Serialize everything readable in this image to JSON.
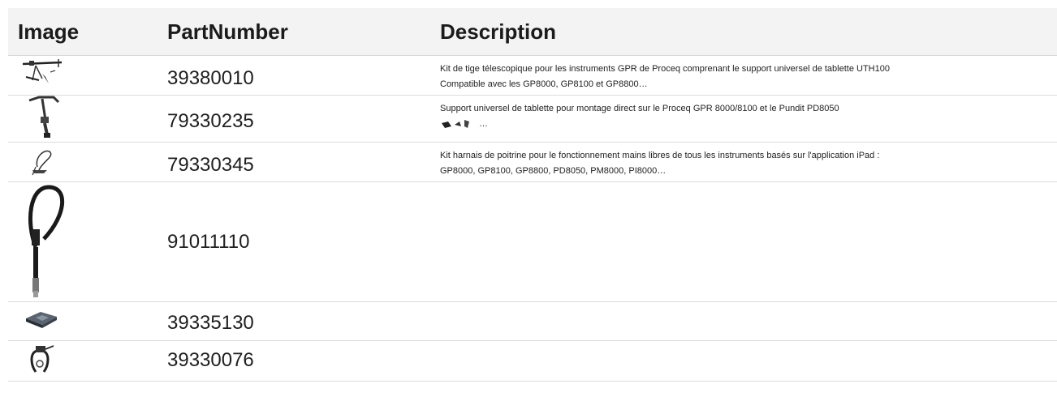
{
  "table": {
    "headers": {
      "image": "Image",
      "part_number": "PartNumber",
      "description": "Description"
    },
    "rows": [
      {
        "part_number": "39380010",
        "thumbnail": "telescopic-rod-icon",
        "desc_line1": "Kit de tige télescopique pour les instruments GPR de Proceq comprenant le support universel de tablette UTH100",
        "desc_line2": "Compatible avec les GP8000, GP8100 et GP8800…"
      },
      {
        "part_number": "79330235",
        "thumbnail": "tablet-holder-icon",
        "desc_line1": "Support universel de tablette pour montage direct sur le Proceq GPR 8000/8100 et le Pundit PD8050",
        "desc_line2": "…"
      },
      {
        "part_number": "79330345",
        "thumbnail": "chest-harness-icon",
        "desc_line1": "Kit harnais de poitrine pour le fonctionnement mains libres de tous les instruments basés sur l'application iPad :",
        "desc_line2": "GP8000, GP8100, GP8800, PD8050, PM8000, PI8000…"
      },
      {
        "part_number": "91011110",
        "thumbnail": "cable-icon",
        "desc_line1": "",
        "desc_line2": ""
      },
      {
        "part_number": "39335130",
        "thumbnail": "battery-pad-icon",
        "desc_line1": "",
        "desc_line2": ""
      },
      {
        "part_number": "39330076",
        "thumbnail": "clamp-icon",
        "desc_line1": "",
        "desc_line2": ""
      }
    ]
  }
}
